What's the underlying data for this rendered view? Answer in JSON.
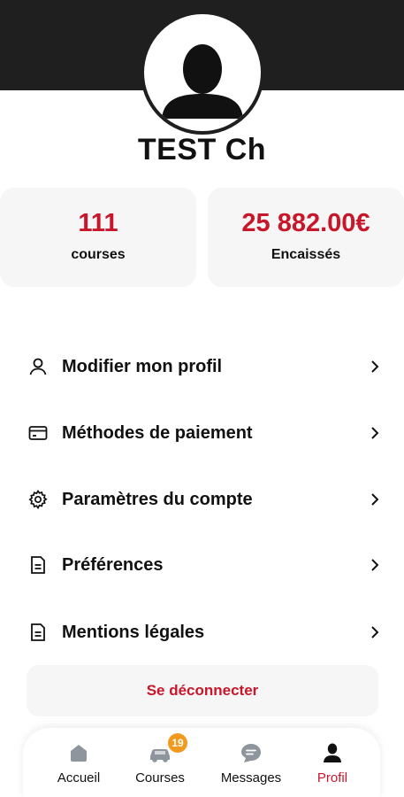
{
  "profile": {
    "name": "TEST Ch"
  },
  "stats": [
    {
      "value": "111",
      "label": "courses"
    },
    {
      "value": "25 882.00€",
      "label": "Encaissés"
    }
  ],
  "menu": [
    {
      "label": "Modifier mon profil",
      "icon": "user-icon"
    },
    {
      "label": "Méthodes de paiement",
      "icon": "credit-card-icon"
    },
    {
      "label": "Paramètres du compte",
      "icon": "gear-icon"
    },
    {
      "label": "Préférences",
      "icon": "document-icon"
    },
    {
      "label": "Mentions légales",
      "icon": "document-icon"
    }
  ],
  "logout": {
    "label": "Se déconnecter"
  },
  "tabs": [
    {
      "label": "Accueil",
      "icon": "home-icon",
      "active": false
    },
    {
      "label": "Courses",
      "icon": "car-icon",
      "active": false,
      "badge": "19"
    },
    {
      "label": "Messages",
      "icon": "chat-icon",
      "active": false
    },
    {
      "label": "Profil",
      "icon": "person-icon",
      "active": true
    }
  ],
  "colors": {
    "accent": "#c8162a",
    "header": "#1f1f1f",
    "card": "#f6f6f6",
    "badge": "#f39a1e",
    "tab_inactive_icon": "#8e959c"
  }
}
